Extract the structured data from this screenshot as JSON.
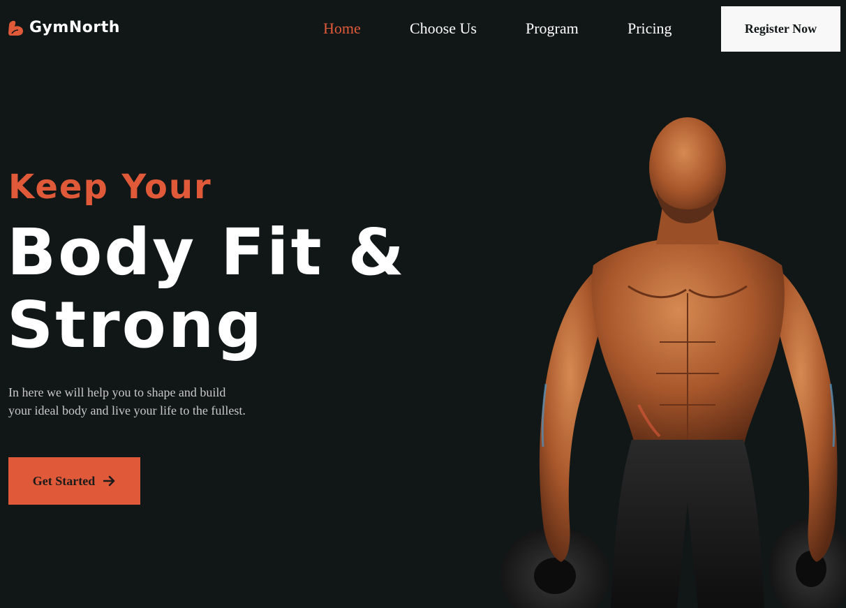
{
  "brand": {
    "name": "GymNorth",
    "icon": "flexed-arm-icon",
    "accent_color": "#e05a3a"
  },
  "nav": {
    "items": [
      {
        "label": "Home",
        "active": true
      },
      {
        "label": "Choose Us",
        "active": false
      },
      {
        "label": "Program",
        "active": false
      },
      {
        "label": "Pricing",
        "active": false
      }
    ],
    "register_label": "Register Now"
  },
  "hero": {
    "tagline": "Keep Your",
    "title_line1": "Body Fit &",
    "title_line2": "Strong",
    "description_line1": "In here we will help you to shape and build",
    "description_line2": "your ideal body and live your life to the fullest.",
    "cta_label": "Get Started",
    "cta_icon": "arrow-right-icon"
  },
  "colors": {
    "background": "#111717",
    "accent": "#e05a3a",
    "text": "#ffffff",
    "muted_text": "#c9c9c9"
  }
}
